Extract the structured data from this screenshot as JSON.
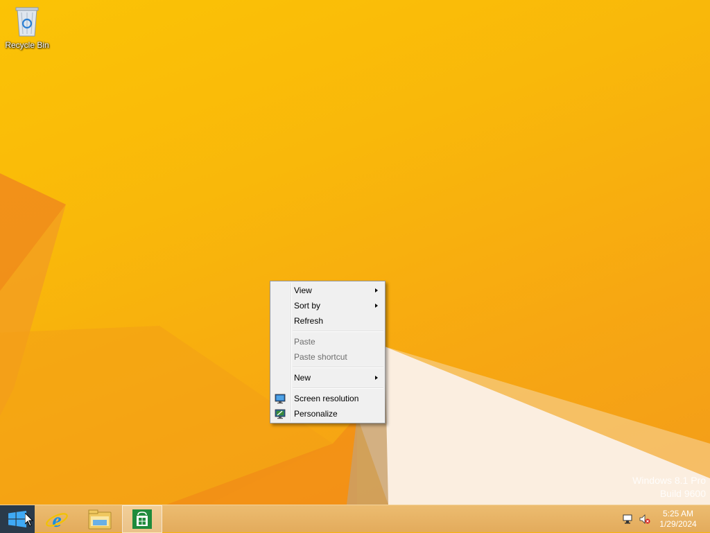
{
  "desktop": {
    "icons": [
      {
        "label": "Recycle Bin",
        "icon": "recycle-bin-icon"
      }
    ],
    "watermark": {
      "line1": "Windows 8.1 Pro",
      "line2": "Build 9600"
    }
  },
  "context_menu": {
    "items": [
      {
        "label": "View",
        "submenu": true,
        "enabled": true
      },
      {
        "label": "Sort by",
        "submenu": true,
        "enabled": true
      },
      {
        "label": "Refresh",
        "submenu": false,
        "enabled": true
      },
      {
        "label": "Paste",
        "submenu": false,
        "enabled": false
      },
      {
        "label": "Paste shortcut",
        "submenu": false,
        "enabled": false
      },
      {
        "label": "New",
        "submenu": true,
        "enabled": true
      },
      {
        "label": "Screen resolution",
        "submenu": false,
        "enabled": true,
        "icon": "screen-resolution-icon"
      },
      {
        "label": "Personalize",
        "submenu": false,
        "enabled": true,
        "icon": "personalize-icon"
      }
    ]
  },
  "taskbar": {
    "pinned": [
      {
        "name": "Internet Explorer",
        "icon": "internet-explorer-icon"
      },
      {
        "name": "File Explorer",
        "icon": "file-explorer-icon"
      },
      {
        "name": "Store",
        "icon": "store-icon",
        "active": true
      }
    ],
    "tray": {
      "network_icon": "network-icon",
      "volume_icon": "volume-muted-icon",
      "time": "5:25 AM",
      "date": "1/29/2024"
    }
  },
  "colors": {
    "wallpaper": "#f9b80a",
    "taskbar": "#e3ab5c",
    "menu_bg": "#f0f0f0"
  }
}
